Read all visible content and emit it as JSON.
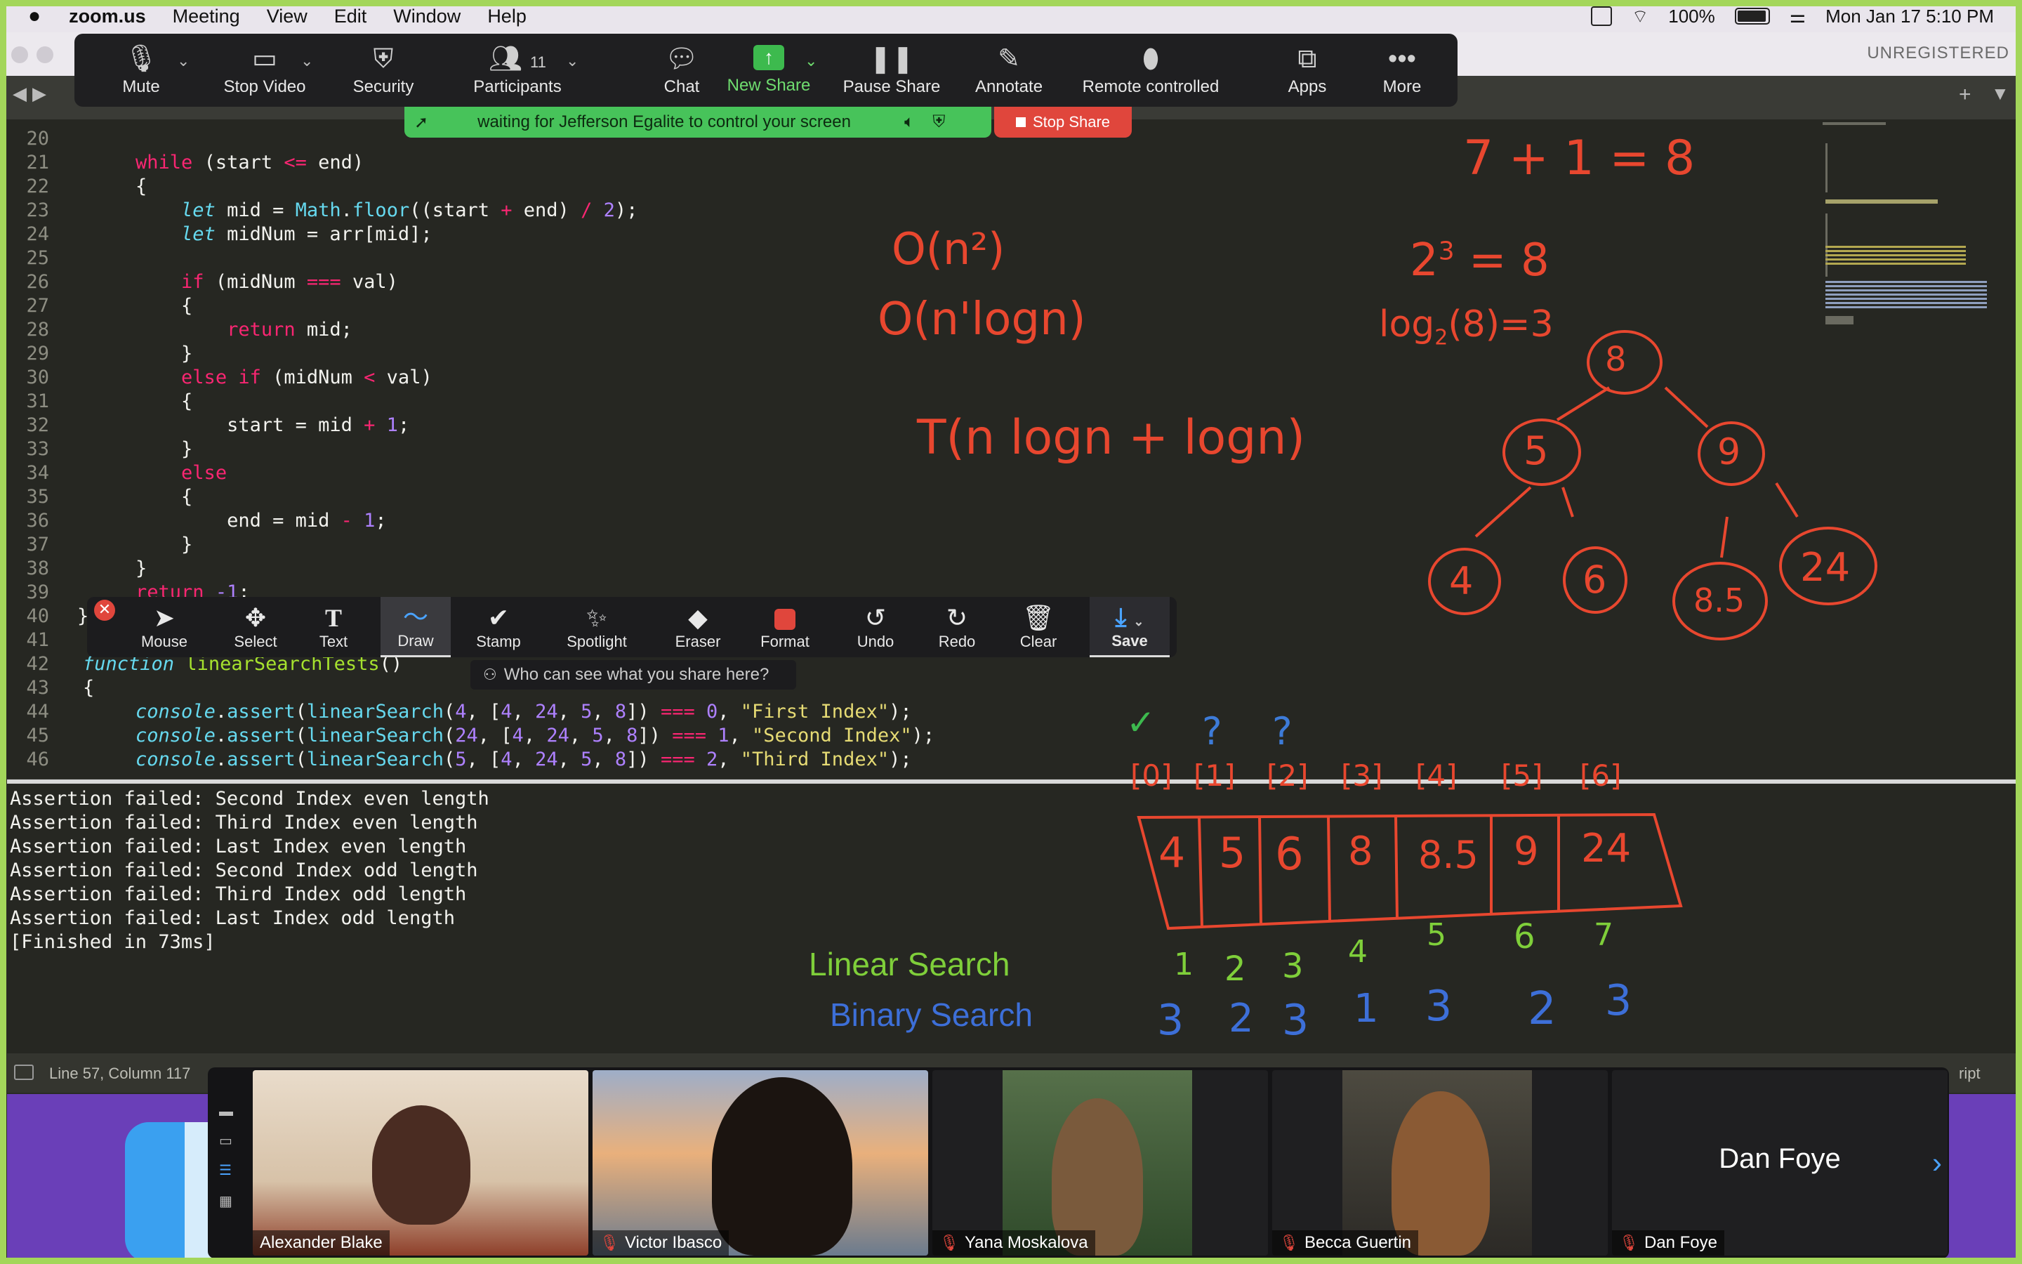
{
  "menubar": {
    "app": "zoom.us",
    "items": [
      "Meeting",
      "View",
      "Edit",
      "Window",
      "Help"
    ],
    "battery": "100%",
    "datetime": "Mon Jan 17  5:10 PM"
  },
  "window": {
    "unregistered": "UNREGISTERED"
  },
  "zoom_toolbar": {
    "mute": "Mute",
    "stop_video": "Stop Video",
    "security": "Security",
    "participants": "Participants",
    "participant_count": "11",
    "chat": "Chat",
    "new_share": "New Share",
    "pause_share": "Pause Share",
    "annotate": "Annotate",
    "remote_controlled": "Remote controlled",
    "apps": "Apps",
    "more": "More"
  },
  "share_banner": {
    "text": "waiting for Jefferson Egalite to control your screen",
    "stop_share": "Stop Share"
  },
  "editor": {
    "line_numbers": [
      "20",
      "21",
      "22",
      "23",
      "24",
      "25",
      "26",
      "27",
      "28",
      "29",
      "30",
      "31",
      "32",
      "33",
      "34",
      "35",
      "36",
      "37",
      "38",
      "39",
      "40",
      "41",
      "42",
      "43",
      "44",
      "45",
      "46"
    ],
    "l21a": "    ",
    "l21kw": "while",
    "l21b": " (start ",
    "l21op": "<=",
    "l21c": " end)",
    "l22": "    {",
    "l23a": "        ",
    "l23kw": "let",
    "l23b": " mid = ",
    "l23fn": "Math",
    "l23c": ".",
    "l23fn2": "floor",
    "l23d": "((start ",
    "l23op": "+",
    "l23e": " end) ",
    "l23op2": "/",
    "l23f": " ",
    "l23num": "2",
    "l23g": ");",
    "l24a": "        ",
    "l24kw": "let",
    "l24b": " midNum = arr[mid];",
    "l26a": "        ",
    "l26kw": "if",
    "l26b": " (midNum ",
    "l26op": "===",
    "l26c": " val)",
    "l27": "        {",
    "l28a": "            ",
    "l28kw": "return",
    "l28b": " mid;",
    "l29": "        }",
    "l30a": "        ",
    "l30kw": "else if",
    "l30b": " (midNum ",
    "l30op": "<",
    "l30c": " val)",
    "l31": "        {",
    "l32a": "            start = mid ",
    "l32op": "+",
    "l32b": " ",
    "l32num": "1",
    "l32c": ";",
    "l33": "        }",
    "l34a": "        ",
    "l34kw": "else",
    "l35": "        {",
    "l36a": "            end = mid ",
    "l36op": "-",
    "l36b": " ",
    "l36num": "1",
    "l36c": ";",
    "l37": "        }",
    "l38": "    }",
    "l39a": "    ",
    "l39kw": "return",
    "l39b": " ",
    "l39num": "-1",
    "l39c": ";",
    "l40": "}",
    "l42kw": "function",
    "l42b": " ",
    "l42fn": "linearSearchTests",
    "l42c": "()",
    "l43": "{",
    "l44a": "    ",
    "l44it": "console",
    "l44b": ".",
    "l44fn": "assert",
    "l44c": "(",
    "l44fn2": "linearSearch",
    "l44d": "(",
    "l44n1": "4",
    "l44e": ", [",
    "l44n2": "4",
    "l44f": ", ",
    "l44n3": "24",
    "l44g": ", ",
    "l44n4": "5",
    "l44h": ", ",
    "l44n5": "8",
    "l44i": "]) ",
    "l44op": "===",
    "l44j": " ",
    "l44n6": "0",
    "l44k": ", ",
    "l44str": "\"First Index\"",
    "l44l": ");",
    "l45a": "    ",
    "l45it": "console",
    "l45b": ".",
    "l45fn": "assert",
    "l45c": "(",
    "l45fn2": "linearSearch",
    "l45d": "(",
    "l45n1": "24",
    "l45e": ", [",
    "l45n2": "4",
    "l45f": ", ",
    "l45n3": "24",
    "l45g": ", ",
    "l45n4": "5",
    "l45h": ", ",
    "l45n5": "8",
    "l45i": "]) ",
    "l45op": "===",
    "l45j": " ",
    "l45n6": "1",
    "l45k": ", ",
    "l45str": "\"Second Index\"",
    "l45l": ");",
    "l46a": "    ",
    "l46it": "console",
    "l46b": ".",
    "l46fn": "assert",
    "l46c": "(",
    "l46fn2": "linearSearch",
    "l46d": "(",
    "l46n1": "5",
    "l46e": ", [",
    "l46n2": "4",
    "l46f": ", ",
    "l46n3": "24",
    "l46g": ", ",
    "l46n4": "5",
    "l46h": ", ",
    "l46n5": "8",
    "l46i": "]) ",
    "l46op": "===",
    "l46j": " ",
    "l46n6": "2",
    "l46k": ", ",
    "l46str": "\"Third Index\"",
    "l46l": ");"
  },
  "output": [
    "Assertion failed: Second Index even length",
    "Assertion failed: Third Index even length",
    "Assertion failed: Last Index even length",
    "Assertion failed: Second Index odd length",
    "Assertion failed: Third Index odd length",
    "Assertion failed: Last Index odd length",
    "[Finished in 73ms]"
  ],
  "status": {
    "position": "Line 57, Column 117",
    "syntax": "ript"
  },
  "annotate_toolbar": {
    "mouse": "Mouse",
    "select": "Select",
    "text": "Text",
    "draw": "Draw",
    "stamp": "Stamp",
    "spotlight": "Spotlight",
    "eraser": "Eraser",
    "format": "Format",
    "undo": "Undo",
    "redo": "Redo",
    "clear": "Clear",
    "save": "Save",
    "who_can_see": "Who can see what you share here?"
  },
  "handwriting": {
    "eq1": "7 + 1 = 8",
    "eq2a": "2",
    "eq2b": "3",
    "eq2c": " = 8",
    "eq3a": "log",
    "eq3b": "2",
    "eq3c": "(8)=3",
    "big_o1": "O(n²)",
    "big_o2": "O(n'logn)",
    "big_o3": "T(n logn + logn)",
    "tree": [
      "8",
      "5",
      "9",
      "4",
      "6",
      "8.5",
      "24"
    ],
    "checks": [
      "✓",
      "?",
      "?"
    ],
    "indices": [
      "[0]",
      "[1]",
      "[2]",
      "[3]",
      "[4]",
      "[5]",
      "[6]"
    ],
    "array": [
      "4",
      "5",
      "6",
      "8",
      "8.5",
      "9",
      "24"
    ],
    "linear_counts": [
      "1",
      "2",
      "3",
      "4",
      "5",
      "6",
      "7"
    ],
    "binary_counts": [
      "3",
      "2",
      "3",
      "1",
      "3",
      "2",
      "3"
    ],
    "linear_label": "Linear Search",
    "binary_label": "Binary Search"
  },
  "gallery": {
    "participants": [
      "Alexander Blake",
      "Victor Ibasco",
      "Yana Moskalova",
      "Becca Guertin",
      "Dan Foye"
    ],
    "dan_foye_tile": "Dan Foye"
  },
  "colors": {
    "accent_green": "#47c35a",
    "stop_red": "#e0463c",
    "ink_red": "#e8472f",
    "linear_green": "#7fcf3a",
    "binary_blue": "#3d6fd8"
  }
}
